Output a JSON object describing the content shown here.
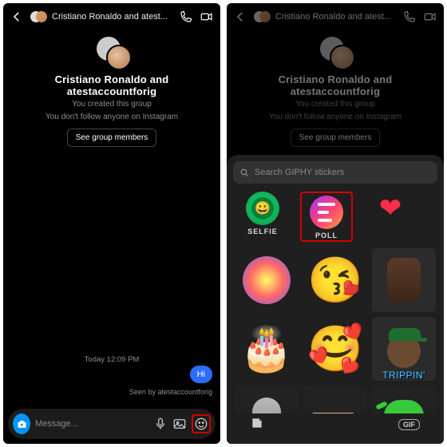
{
  "header": {
    "title": "Cristiano Ronaldo and atest..."
  },
  "group": {
    "name": "Cristiano Ronaldo and atestaccountforig",
    "created": "You created this group",
    "follow": "You don't follow anyone on Instagram",
    "members_btn": "See group members"
  },
  "chat": {
    "today": "Today 12:09 PM",
    "hi": "Hi",
    "seen": "Seen by atestaccountforig"
  },
  "composer": {
    "placeholder": "Message..."
  },
  "stickers": {
    "search_placeholder": "Search GIPHY stickers",
    "selfie_label": "SELFIE",
    "poll_label": "POLL",
    "trippin_label": "TRIPPIN'",
    "gif_label": "GIF"
  }
}
